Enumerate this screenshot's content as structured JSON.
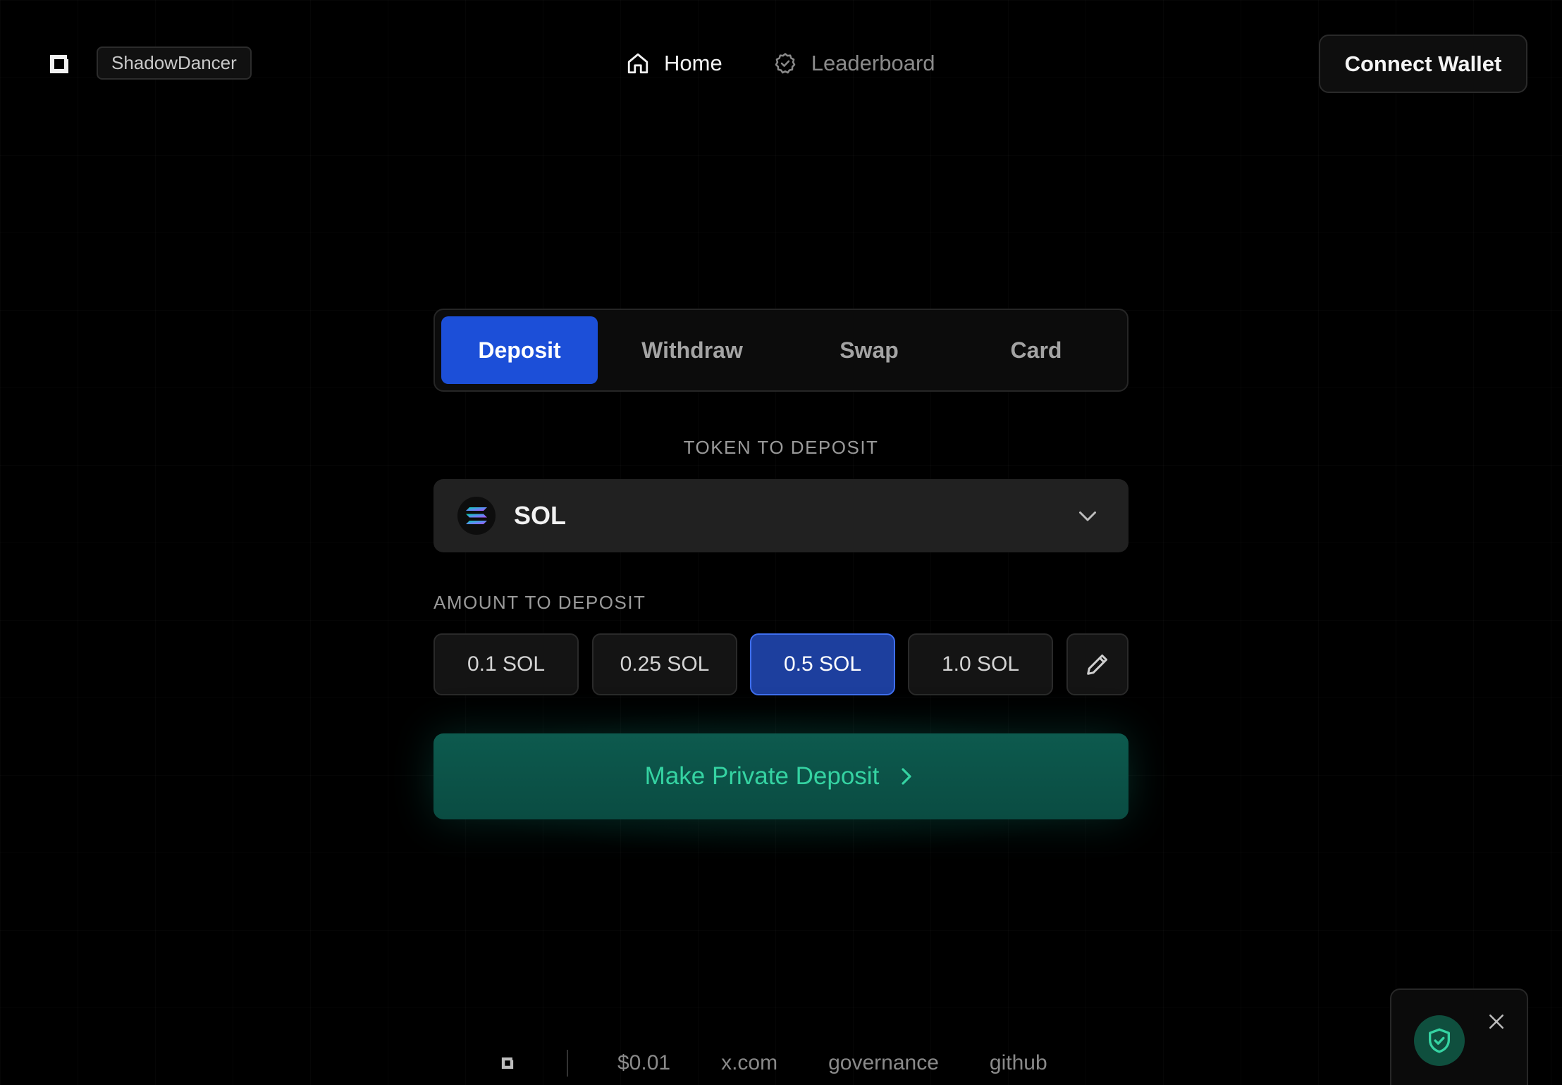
{
  "header": {
    "logo_icon": "square-logo-icon",
    "username": "ShadowDancer",
    "nav": [
      {
        "label": "Home",
        "icon": "home-icon",
        "active": true
      },
      {
        "label": "Leaderboard",
        "icon": "check-badge-icon",
        "active": false
      }
    ],
    "connect_label": "Connect Wallet"
  },
  "tabs": [
    {
      "label": "Deposit",
      "active": true
    },
    {
      "label": "Withdraw",
      "active": false
    },
    {
      "label": "Swap",
      "active": false
    },
    {
      "label": "Card",
      "active": false
    }
  ],
  "token": {
    "section_label": "TOKEN TO DEPOSIT",
    "selected": "SOL",
    "icon": "solana-icon"
  },
  "amount": {
    "section_label": "AMOUNT TO DEPOSIT",
    "options": [
      "0.1 SOL",
      "0.25 SOL",
      "0.5 SOL",
      "1.0 SOL"
    ],
    "selected": "0.5 SOL",
    "custom_icon": "pencil-icon"
  },
  "action": {
    "label": "Make Private Deposit",
    "icon": "chevron-right-icon"
  },
  "footer": {
    "price": "$0.01",
    "links": [
      "x.com",
      "governance",
      "github"
    ]
  },
  "colors": {
    "accent_blue": "#1c4fd8",
    "selected_amount": "#1d3f9e",
    "deposit_bg": "#0a4c42",
    "deposit_text": "#35d3a2"
  }
}
